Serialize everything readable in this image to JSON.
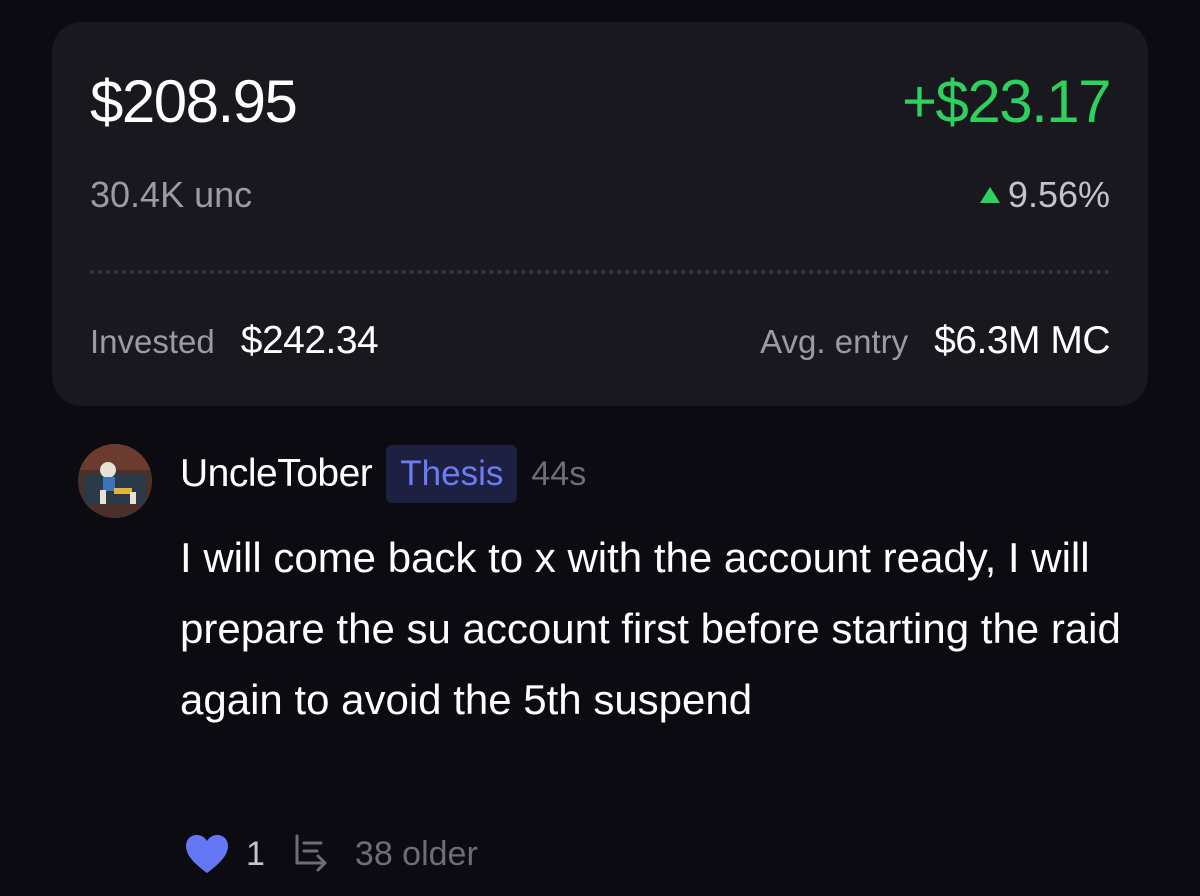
{
  "position": {
    "value": "$208.95",
    "pnl": "+$23.17",
    "tokens": "30.4K unc",
    "pnl_pct": "9.56%",
    "invested_label": "Invested",
    "invested_value": "$242.34",
    "avg_entry_label": "Avg. entry",
    "avg_entry_value": "$6.3M MC"
  },
  "comment": {
    "username": "UncleTober",
    "tag": "Thesis",
    "time": "44s",
    "text": "I will come back to x with the account ready, I will prepare the su account first before starting the raid again to avoid the 5th suspend",
    "likes": "1",
    "older_label": "38 older"
  },
  "icons": {
    "pnl_direction": "triangle-up-icon",
    "like": "heart-icon",
    "older": "reply-thread-icon"
  },
  "colors": {
    "background": "#0c0b12",
    "card": "#19181f",
    "positive": "#2ed15d",
    "tag_bg": "#1d2040",
    "tag_text": "#6c7cf6",
    "heart": "#6478f5"
  }
}
